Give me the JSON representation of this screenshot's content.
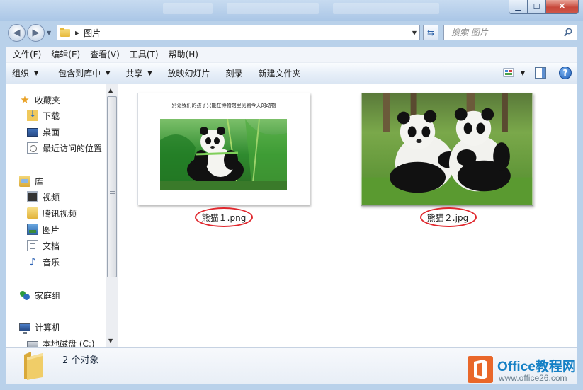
{
  "window": {
    "controls": {
      "minimize": "▁",
      "maximize": "☐",
      "close": "✕"
    }
  },
  "address": {
    "path": "图片",
    "search_placeholder": "搜索 图片"
  },
  "menu": [
    "文件(F)",
    "编辑(E)",
    "查看(V)",
    "工具(T)",
    "帮助(H)"
  ],
  "toolbar": {
    "organize": "组织",
    "include_library": "包含到库中",
    "share": "共享",
    "slideshow": "放映幻灯片",
    "burn": "刻录",
    "new_folder": "新建文件夹"
  },
  "nav": {
    "favorites": {
      "label": "收藏夹",
      "items": [
        "下载",
        "桌面",
        "最近访问的位置"
      ]
    },
    "libraries": {
      "label": "库",
      "items": [
        "视频",
        "腾讯视频",
        "图片",
        "文档",
        "音乐"
      ]
    },
    "homegroup": "家庭组",
    "computer": {
      "label": "计算机",
      "items": [
        "本地磁盘 (C:)"
      ]
    }
  },
  "files": [
    {
      "name": "熊猫１.png",
      "caption": "别让我们的孩子只能在博物馆里见到今天的动物"
    },
    {
      "name": "熊猫２.jpg"
    }
  ],
  "status": {
    "count": "2 个对象"
  },
  "watermark": {
    "brand": "Office教程网",
    "url": "www.office26.com"
  },
  "colors": {
    "highlight_oval": "#e0282e",
    "watermark_orange": "#e9672a",
    "watermark_blue": "#1580c5"
  }
}
